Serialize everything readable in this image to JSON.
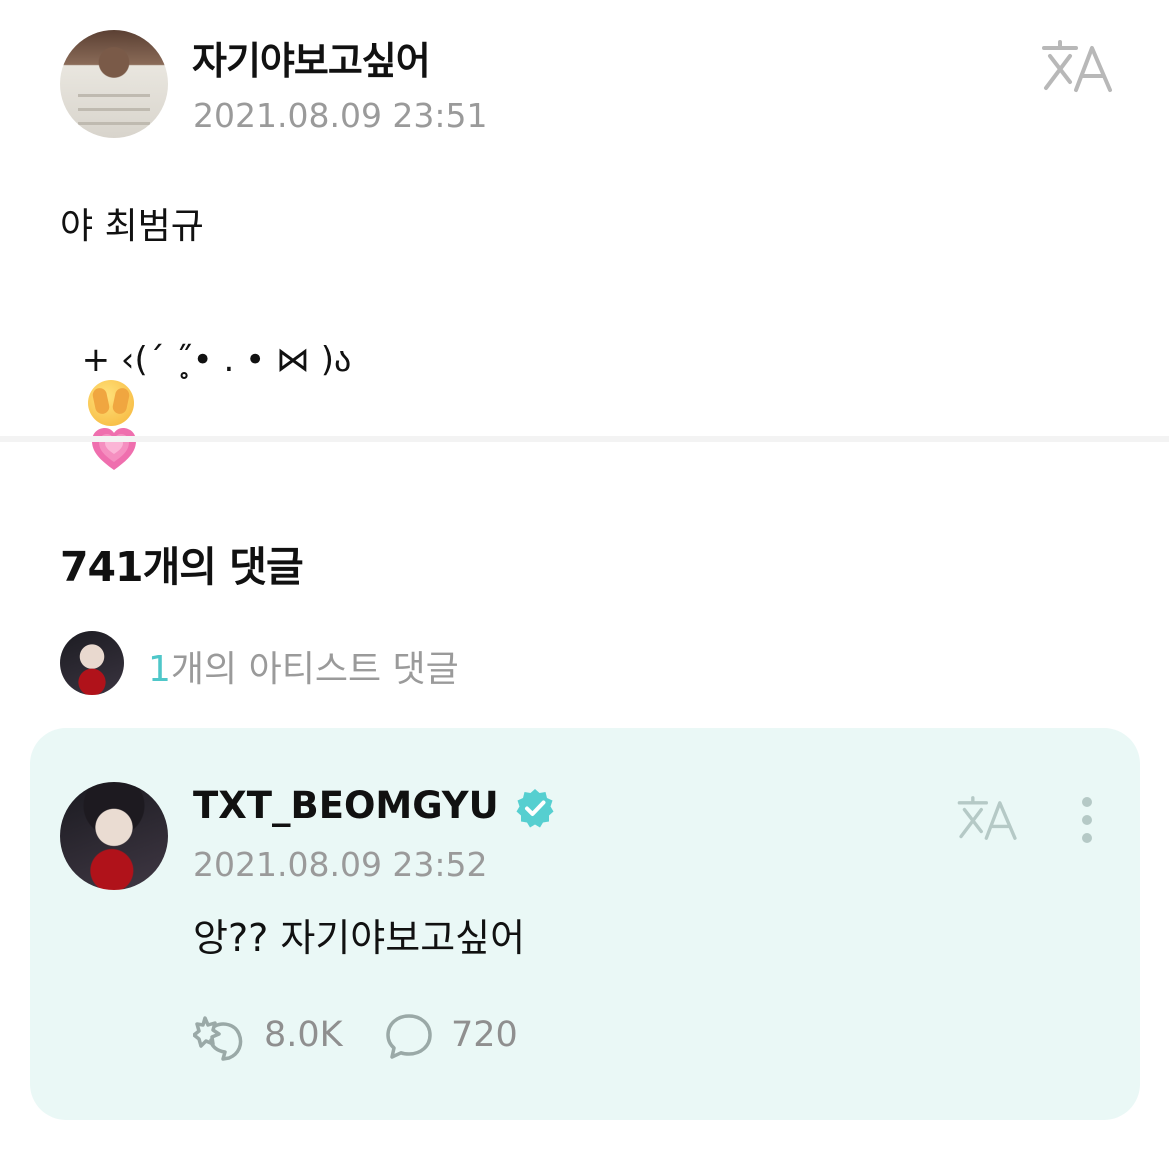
{
  "post": {
    "author": "자기야보고싶어",
    "timestamp": "2021.08.09 23:51",
    "body_line1": "야 최범규",
    "body_line2": "+ ‹(´ ˝̥• . • ⋈ )ა",
    "emojis": [
      "face-with-hand-over-eyes",
      "growing-heart"
    ],
    "translate_icon": "translate-icon"
  },
  "comments": {
    "count_label": "741개의 댓글",
    "artist_summary": {
      "count": "1",
      "label": "개의 아티스트 댓글"
    }
  },
  "artist_comment": {
    "author": "TXT_BEOMGYU",
    "verified": true,
    "timestamp": "2021.08.09 23:52",
    "text": "앙?? 자기야보고싶어",
    "likes": "8.0K",
    "replies": "720"
  },
  "colors": {
    "accent": "#4fc7c9",
    "card_bg": "#eaf8f6",
    "muted_text": "#9a9a9a"
  }
}
